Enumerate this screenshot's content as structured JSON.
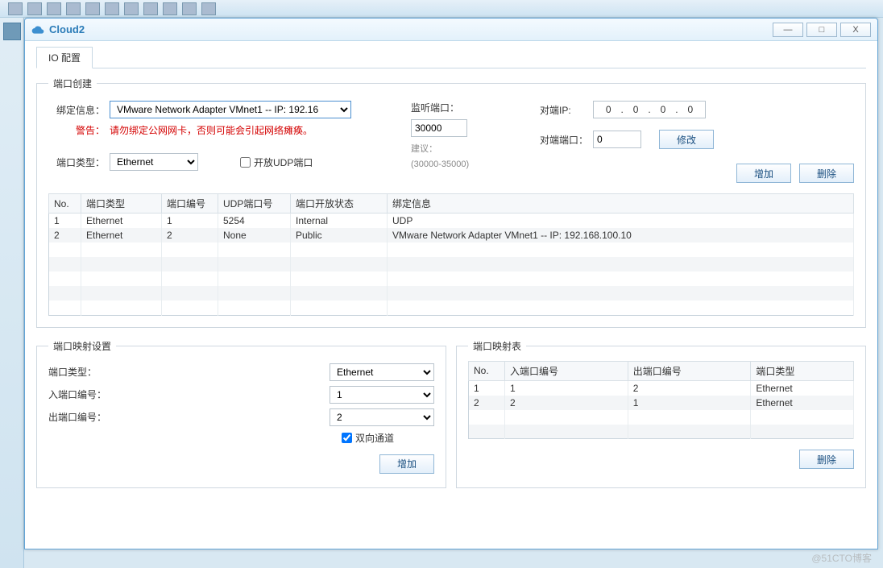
{
  "window": {
    "title": "Cloud2"
  },
  "tab": {
    "label": "IO 配置"
  },
  "port_create": {
    "legend": "端口创建",
    "bind_label": "绑定信息：",
    "bind_value": "VMware Network Adapter VMnet1 -- IP: 192.16",
    "warn_label": "警告：",
    "warn_text": "请勿绑定公网网卡，否则可能会引起网络瘫痪。",
    "port_type_label": "端口类型：",
    "port_type_value": "Ethernet",
    "open_udp_label": "开放UDP端口",
    "listen_port_label": "监听端口：",
    "listen_port_value": "30000",
    "suggest_label": "建议：",
    "suggest_text": "(30000-35000)",
    "peer_ip_label": "对端IP:",
    "peer_ip": [
      "0",
      "0",
      "0",
      "0"
    ],
    "peer_port_label": "对端端口：",
    "peer_port_value": "0",
    "modify_btn": "修改",
    "add_btn": "增加",
    "delete_btn": "删除"
  },
  "port_table": {
    "headers": [
      "No.",
      "端口类型",
      "端口编号",
      "UDP端口号",
      "端口开放状态",
      "绑定信息"
    ],
    "rows": [
      {
        "no": "1",
        "type": "Ethernet",
        "num": "1",
        "udp": "5254",
        "state": "Internal",
        "bind": "UDP"
      },
      {
        "no": "2",
        "type": "Ethernet",
        "num": "2",
        "udp": "None",
        "state": "Public",
        "bind": "VMware Network Adapter VMnet1 -- IP: 192.168.100.10"
      }
    ]
  },
  "map_setting": {
    "legend": "端口映射设置",
    "port_type_label": "端口类型：",
    "port_type_value": "Ethernet",
    "in_port_label": "入端口编号：",
    "in_port_value": "1",
    "out_port_label": "出端口编号：",
    "out_port_value": "2",
    "bidir_label": "双向通道",
    "add_btn": "增加"
  },
  "map_table": {
    "legend": "端口映射表",
    "headers": [
      "No.",
      "入端口编号",
      "出端口编号",
      "端口类型"
    ],
    "rows": [
      {
        "no": "1",
        "in": "1",
        "out": "2",
        "type": "Ethernet"
      },
      {
        "no": "2",
        "in": "2",
        "out": "1",
        "type": "Ethernet"
      }
    ],
    "delete_btn": "删除"
  },
  "watermark": "@51CTO博客"
}
